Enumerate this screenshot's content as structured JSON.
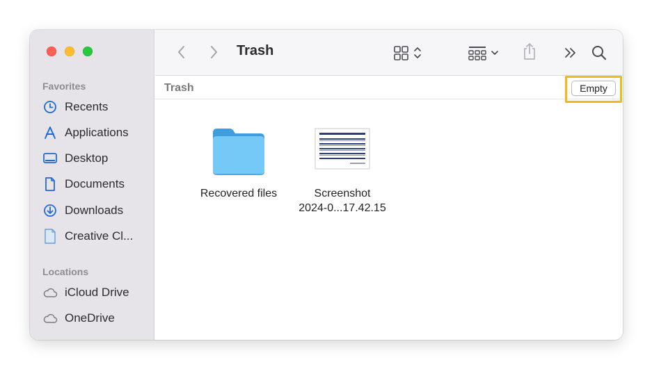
{
  "window": {
    "title": "Trash"
  },
  "sidebar": {
    "favorites_title": "Favorites",
    "favorites": [
      {
        "label": "Recents",
        "icon": "clock-icon"
      },
      {
        "label": "Applications",
        "icon": "applications-icon"
      },
      {
        "label": "Desktop",
        "icon": "desktop-icon"
      },
      {
        "label": "Documents",
        "icon": "document-icon"
      },
      {
        "label": "Downloads",
        "icon": "download-icon"
      },
      {
        "label": "Creative Cl...",
        "icon": "file-icon"
      }
    ],
    "locations_title": "Locations",
    "locations": [
      {
        "label": "iCloud Drive",
        "icon": "cloud-icon"
      },
      {
        "label": "OneDrive",
        "icon": "cloud-icon"
      }
    ]
  },
  "pathbar": {
    "label": "Trash",
    "empty_label": "Empty"
  },
  "files": [
    {
      "name": "Recovered files",
      "kind": "folder"
    },
    {
      "name": "Screenshot",
      "name_line2": "2024-0...17.42.15",
      "kind": "image"
    }
  ],
  "colors": {
    "accent": "#1e6bd6",
    "highlight": "#f5b81c",
    "folder": "#5ab8f0"
  }
}
